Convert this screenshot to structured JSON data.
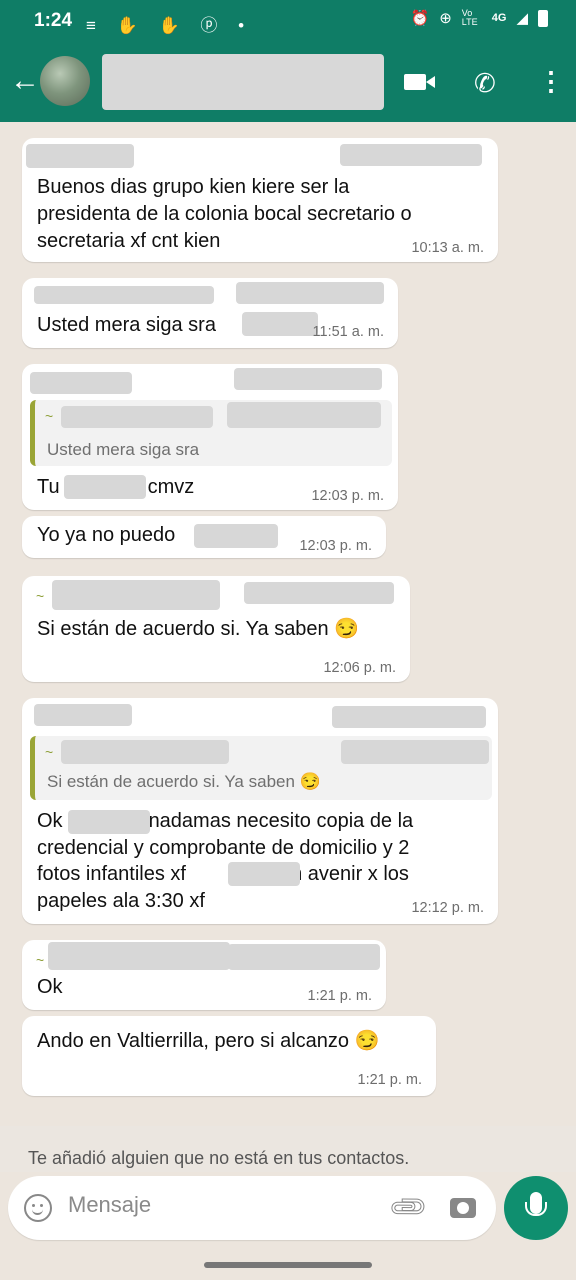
{
  "status_bar": {
    "time": "1:24",
    "network": "4G",
    "volte": "Vo LTE"
  },
  "header": {
    "back_icon": "arrow-left-icon",
    "video_icon": "video-camera-icon",
    "call_icon": "phone-icon",
    "more_icon": "more-vertical-icon"
  },
  "messages": [
    {
      "text_lines": [
        "Buenos dias grupo kien kiere ser la",
        "presidenta de la colonia bocal secretario o",
        "secretaria xf cnt kien"
      ],
      "time": "10:13 a. m."
    },
    {
      "text": "Usted mera siga sra",
      "time": "11:51 a. m."
    },
    {
      "quote": "Usted mera siga sra",
      "text_a": "Tu",
      "text_b": "cmvz",
      "time": "12:03 p. m."
    },
    {
      "text": "Yo ya no puedo",
      "time": "12:03 p. m."
    },
    {
      "text": "Si están de acuerdo si. Ya saben 😏",
      "time": "12:06 p. m."
    },
    {
      "quote": "Si están de acuerdo si. Ya saben 😏",
      "text_lines": [
        "Ok",
        "nadamas necesito copia de la",
        "credencial y comprobante de domicilio y 2",
        "fotos infantiles xf",
        "van avenir x los",
        "papeles  ala 3:30 xf"
      ],
      "time": "12:12 p. m."
    },
    {
      "text": "Ok",
      "time": "1:21 p. m."
    },
    {
      "text": "Ando en Valtierrilla, pero si alcanzo 😏",
      "time": "1:21 p. m."
    }
  ],
  "tilde": "~",
  "notice": "Te añadió alguien que no está en tus contactos.",
  "composer": {
    "placeholder": "Mensaje"
  },
  "colors": {
    "header": "#0f7d66",
    "accent": "#0f8f6f",
    "chat_background": "#ece5dd",
    "quote_bar": "#9aa536"
  }
}
